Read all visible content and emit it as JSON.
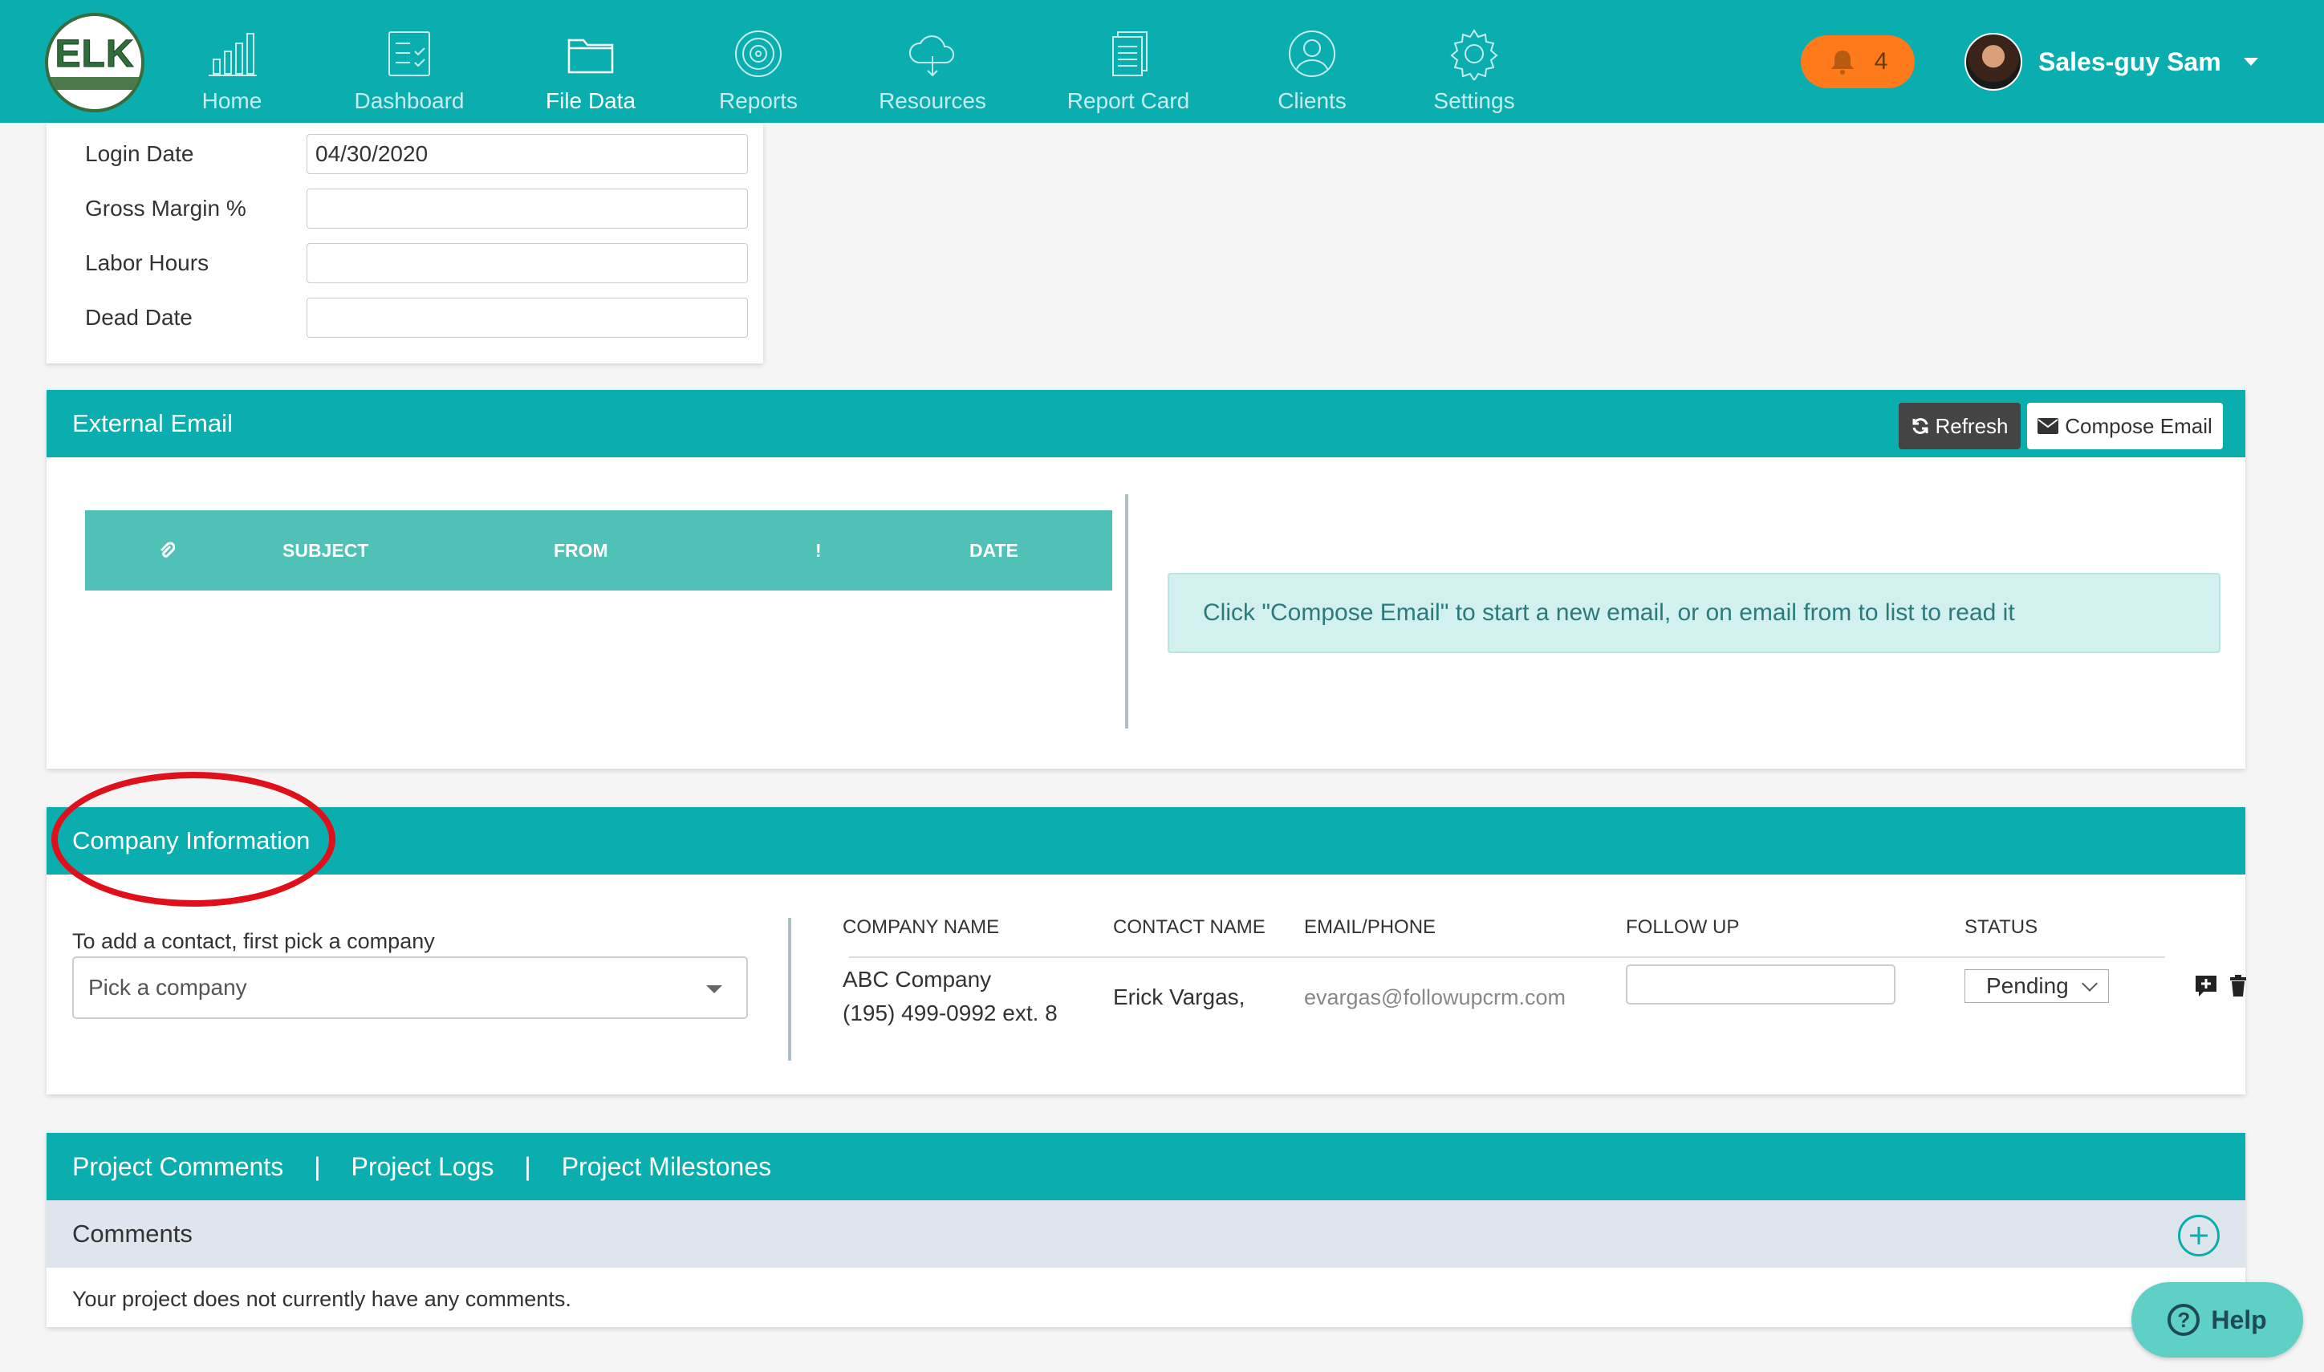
{
  "nav": {
    "logo_text": "ELK",
    "items": [
      {
        "label": "Home",
        "icon": "bar-chart-icon"
      },
      {
        "label": "Dashboard",
        "icon": "checklist-icon"
      },
      {
        "label": "File Data",
        "icon": "folder-icon"
      },
      {
        "label": "Reports",
        "icon": "target-icon"
      },
      {
        "label": "Resources",
        "icon": "cloud-icon"
      },
      {
        "label": "Report Card",
        "icon": "documents-icon"
      },
      {
        "label": "Clients",
        "icon": "user-circle-icon"
      },
      {
        "label": "Settings",
        "icon": "gear-icon"
      }
    ],
    "active": "File Data",
    "notifications_count": "4",
    "user_name": "Sales-guy Sam"
  },
  "form": {
    "rows": [
      {
        "label": "Login Date",
        "value": "04/30/2020"
      },
      {
        "label": "Gross Margin %",
        "value": ""
      },
      {
        "label": "Labor Hours",
        "value": ""
      },
      {
        "label": "Dead Date",
        "value": ""
      }
    ]
  },
  "external_email": {
    "title": "External Email",
    "refresh_label": "Refresh",
    "compose_label": "Compose Email",
    "columns": [
      "SUBJECT",
      "FROM",
      "!",
      "DATE"
    ],
    "info_text": "Click \"Compose Email\" to start a new email, or on email from to list to read it"
  },
  "company_info": {
    "title": "Company Information",
    "add_contact_label": "To add a contact, first pick a company",
    "select_placeholder": "Pick a company",
    "columns": [
      "COMPANY NAME",
      "CONTACT NAME",
      "EMAIL/PHONE",
      "FOLLOW UP",
      "STATUS"
    ],
    "row": {
      "company_name": "ABC Company",
      "company_phone": "(195) 499-0992 ext. 8",
      "contact_name": "Erick Vargas,",
      "email": "evargas@followupcrm.com",
      "follow_up": "",
      "status": "Pending"
    }
  },
  "project": {
    "tabs": [
      "Project Comments",
      "Project Logs",
      "Project Milestones"
    ],
    "separator": "|",
    "comments_title": "Comments",
    "empty_text": "Your project does not currently have any comments."
  },
  "help": {
    "label": "Help"
  },
  "colors": {
    "teal": "#0aaeae",
    "badge_orange": "#ff7a1a",
    "annotation_red": "#e0101a"
  }
}
